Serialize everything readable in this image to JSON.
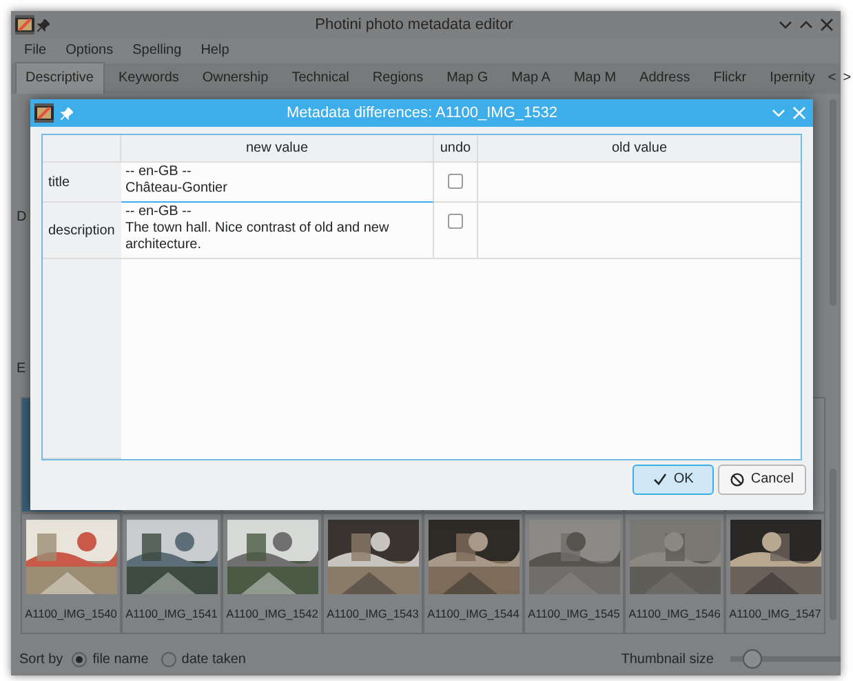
{
  "window": {
    "title": "Photini photo metadata editor"
  },
  "menu": [
    "File",
    "Options",
    "Spelling",
    "Help"
  ],
  "tabs": [
    {
      "label": "Descriptive",
      "selected": true
    },
    {
      "label": "Keywords",
      "selected": false
    },
    {
      "label": "Ownership",
      "selected": false
    },
    {
      "label": "Technical",
      "selected": false
    },
    {
      "label": "Regions",
      "selected": false
    },
    {
      "label": "Map G",
      "selected": false
    },
    {
      "label": "Map A",
      "selected": false
    },
    {
      "label": "Map M",
      "selected": false
    },
    {
      "label": "Address",
      "selected": false
    },
    {
      "label": "Flickr",
      "selected": false
    },
    {
      "label": "Ipernity",
      "selected": false
    }
  ],
  "tab_scroll": [
    "<",
    ">"
  ],
  "panel_labels": [
    "D",
    "E"
  ],
  "thumbnails": [
    {
      "label": "A1100_IMG_1540"
    },
    {
      "label": "A1100_IMG_1541"
    },
    {
      "label": "A1100_IMG_1542"
    },
    {
      "label": "A1100_IMG_1543"
    },
    {
      "label": "A1100_IMG_1544"
    },
    {
      "label": "A1100_IMG_1545"
    },
    {
      "label": "A1100_IMG_1546"
    },
    {
      "label": "A1100_IMG_1547"
    }
  ],
  "status_bar": {
    "sort_label": "Sort by",
    "sort_options": [
      {
        "label": "file name",
        "selected": true
      },
      {
        "label": "date taken",
        "selected": false
      }
    ],
    "size_label": "Thumbnail size",
    "size_slider": {
      "level": 0.2
    }
  },
  "dialog": {
    "title": "Metadata differences: A1100_IMG_1532",
    "columns": [
      "new value",
      "undo",
      "old value"
    ],
    "rows": [
      {
        "label": "title",
        "new_value": "-- en-GB --\nChâteau-Gontier",
        "undo": false
      },
      {
        "label": "description",
        "new_value": "-- en-GB --\nThe town hall. Nice contrast of old and new architecture.",
        "undo": false
      }
    ],
    "buttons": [
      {
        "label": "OK",
        "kind": "ok",
        "default": true
      },
      {
        "label": "Cancel",
        "kind": "cancel",
        "default": false
      }
    ]
  }
}
